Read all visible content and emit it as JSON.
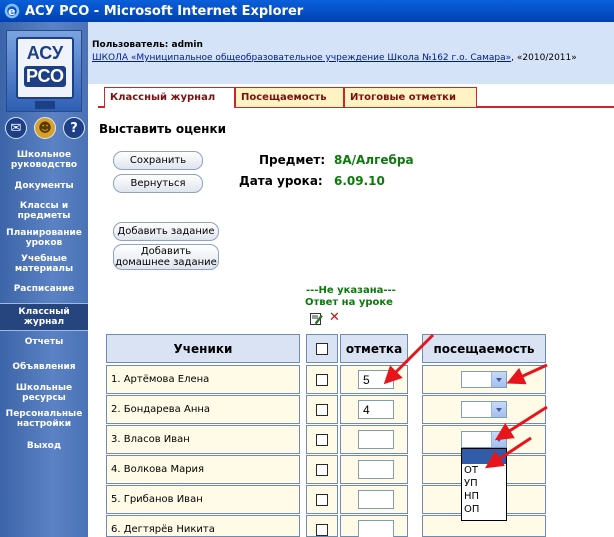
{
  "window": {
    "title": "АСУ РСО - Microsoft Internet Explorer"
  },
  "logo": {
    "line1": "АСУ",
    "line2": "РСО"
  },
  "sidebar": {
    "top_icons": [
      "mail-icon",
      "users-icon",
      "help-icon"
    ],
    "items": [
      {
        "label": "Школьное руководство"
      },
      {
        "label": "Документы"
      },
      {
        "label": "Классы и предметы"
      },
      {
        "label": "Планирование уроков"
      },
      {
        "label": "Учебные материалы"
      },
      {
        "label": "Расписание"
      },
      {
        "label": "Классный журнал",
        "active": true
      },
      {
        "label": "Отчеты"
      },
      {
        "label": "Объявления"
      },
      {
        "label": "Школьные ресурсы"
      },
      {
        "label": "Персональные настройки"
      },
      {
        "label": "Выход"
      }
    ]
  },
  "header": {
    "user": "Пользователь: admin",
    "school_link": "ШКОЛА «Муниципальное общеобразовательное учреждение Школа №162 г.о. Самара»",
    "school_sep": ", ",
    "year": "«2010/2011»"
  },
  "tabs": [
    {
      "label": "Классный журнал",
      "active": true
    },
    {
      "label": "Посещаемость"
    },
    {
      "label": "Итоговые отметки"
    }
  ],
  "main": {
    "title": "Выставить оценки",
    "save_label": "Сохранить",
    "back_label": "Вернуться",
    "subject_label": "Предмет:",
    "subject_value": "8А/Алгебра",
    "date_label": "Дата урока:",
    "date_value": "6.09.10",
    "add_task_label": "Добавить задание",
    "add_homework_line1": "Добавить",
    "add_homework_line2": "домашнее задание",
    "not_specified": "---Не указана---",
    "answer_in_class": "Ответ на уроке"
  },
  "table": {
    "columns": [
      "Ученики",
      "отметка",
      "посещаемость"
    ],
    "rows": [
      {
        "student": "1. Артёмова Елена",
        "mark": "5"
      },
      {
        "student": "2. Бондарева Анна",
        "mark": "4"
      },
      {
        "student": "3. Власов Иван",
        "mark": ""
      },
      {
        "student": "4. Волкова Мария",
        "mark": ""
      },
      {
        "student": "5. Грибанов Иван",
        "mark": ""
      },
      {
        "student": "6. Дегтярёв Никита",
        "mark": ""
      }
    ]
  },
  "attendance_dropdown": {
    "options": [
      "",
      "ОТ",
      "УП",
      "НП",
      "ОП"
    ],
    "highlighted": ""
  },
  "colors": {
    "titlebar": "#0550c8",
    "sidebar": "#5a82c4",
    "header_bg": "#d4e3f7",
    "tab_border": "#c8282a",
    "value_green": "#0a7a0a",
    "annotation_arrow": "#e8141b"
  }
}
